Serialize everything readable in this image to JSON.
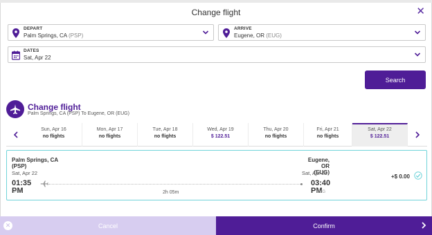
{
  "header": {
    "title": "Change flight",
    "close_label": "✕"
  },
  "depart": {
    "label": "DEPART",
    "city": "Palm Springs, CA",
    "code": "(PSP)"
  },
  "arrive": {
    "label": "ARRIVE",
    "city": "Eugene, OR",
    "code": "(EUG)"
  },
  "dates": {
    "label": "DATES",
    "value": "Sat, Apr 22"
  },
  "search_label": "Search",
  "change_flight": {
    "title": "Change flight",
    "subtitle": "Palm Springs, CA (PSP) To Eugene, OR (EUG)"
  },
  "datebar": {
    "days": [
      {
        "name": "Sun, Apr 16",
        "value": "no flights"
      },
      {
        "name": "Mon, Apr 17",
        "value": "no flights"
      },
      {
        "name": "Tue, Apr 18",
        "value": "no flights"
      },
      {
        "name": "Wed, Apr 19",
        "value": "$ 122.51"
      },
      {
        "name": "Thu, Apr 20",
        "value": "no flights"
      },
      {
        "name": "Fri, Apr 21",
        "value": "no flights"
      },
      {
        "name": "Sat, Apr 22",
        "value": "$ 122.51"
      }
    ]
  },
  "flight": {
    "origin_city": "Palm Springs, CA",
    "origin_code": "(PSP)",
    "origin_date": "Sat, Apr 22",
    "depart_time": "01:35",
    "depart_ampm": "PM",
    "origin_tag": "PSP",
    "dest_city": "Eugene, OR",
    "dest_code": "(EUG)",
    "dest_date": "Sat, Apr 22",
    "arrive_time": "03:40",
    "arrive_ampm": "PM",
    "dest_tag": "EUG",
    "duration": "2h 05m",
    "price": "+$ 0.00"
  },
  "footer": {
    "cancel_label": "Cancel",
    "confirm_label": "Confirm"
  },
  "colors": {
    "brand": "#4f1d97",
    "accent": "#6fd3d9",
    "cancel_bg": "#d7cdf0"
  }
}
